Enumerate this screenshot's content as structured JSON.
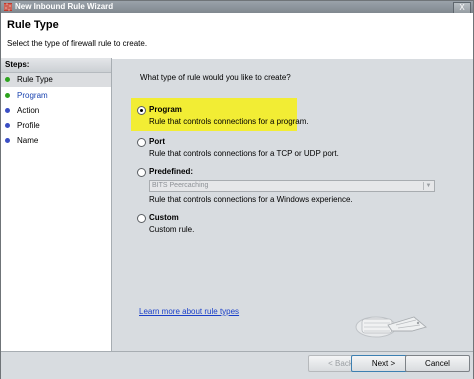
{
  "window": {
    "title": "New Inbound Rule Wizard",
    "close_glyph": "X"
  },
  "header": {
    "title": "Rule Type",
    "subtitle": "Select the type of firewall rule to create."
  },
  "steps": {
    "heading": "Steps:",
    "items": [
      {
        "label": "Rule Type",
        "state": "current"
      },
      {
        "label": "Program",
        "state": "next"
      },
      {
        "label": "Action",
        "state": "pending"
      },
      {
        "label": "Profile",
        "state": "pending"
      },
      {
        "label": "Name",
        "state": "pending"
      }
    ]
  },
  "main": {
    "question": "What type of rule would you like to create?",
    "options": [
      {
        "title": "Program",
        "description": "Rule that controls connections for a program.",
        "selected": true
      },
      {
        "title": "Port",
        "description": "Rule that controls connections for a TCP or UDP port.",
        "selected": false
      },
      {
        "title": "Predefined:",
        "description": "Rule that controls connections for a Windows experience.",
        "selected": false
      },
      {
        "title": "Custom",
        "description": "Custom rule.",
        "selected": false
      }
    ],
    "predefined_select": {
      "value": "BITS Peercaching",
      "enabled": false
    },
    "learn_more_link": "Learn more about rule types"
  },
  "buttons": {
    "back": "< Back",
    "next": "Next >",
    "cancel": "Cancel"
  },
  "colors": {
    "highlight": "#f2ed34",
    "link": "#1a3fc8",
    "panel": "#d8dce0"
  }
}
